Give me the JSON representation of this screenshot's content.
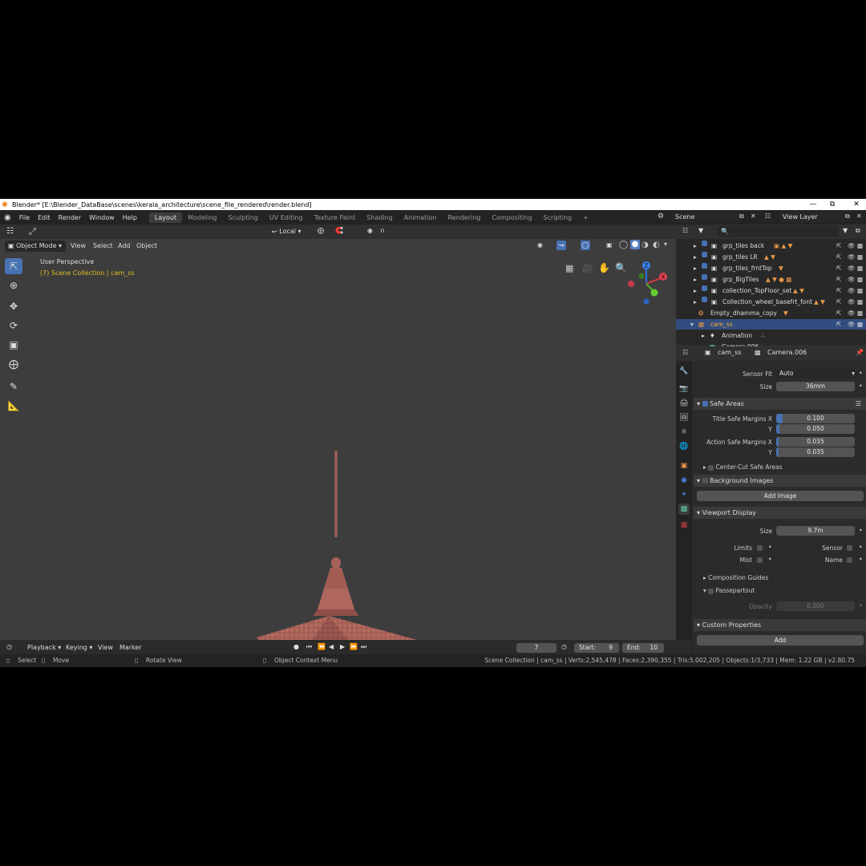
{
  "window": {
    "title": "Blender* [E:\\Blender_DataBase\\scenes\\kerala_architecture\\scene_file_rendered\\render.blend]"
  },
  "menu": {
    "file": "File",
    "edit": "Edit",
    "render": "Render",
    "window": "Window",
    "help": "Help"
  },
  "workspaces": [
    "Layout",
    "Modeling",
    "Sculpting",
    "UV Editing",
    "Texture Paint",
    "Shading",
    "Animation",
    "Rendering",
    "Compositing",
    "Scripting"
  ],
  "topright": {
    "scene": "Scene",
    "view_layer": "View Layer"
  },
  "viewport": {
    "mode": "Object Mode",
    "menus": {
      "view": "View",
      "select": "Select",
      "add": "Add",
      "object": "Object"
    },
    "orientation": "Local",
    "perspective": "User Perspective",
    "collection": "(7) Scene Collection | cam_ss",
    "gizmo": {
      "x": "X",
      "y": "Y",
      "z": "Z"
    }
  },
  "outliner": {
    "rows": [
      "grp_tiles back",
      "grp_tiles LR",
      "grp_tiles_frntTop",
      "grp_BigTiles",
      "collection_TopFloor_set",
      "Collection_wheel_basefrt_font",
      "Empty_dhamma_copy",
      "cam_ss",
      "Animation",
      "Camera.006"
    ]
  },
  "properties": {
    "breadcrumb_object": "cam_ss",
    "breadcrumb_data": "Camera.006",
    "sensor_fit_label": "Sensor Fit",
    "sensor_fit_value": "Auto",
    "size_label": "Size",
    "size_value": "36mm",
    "safe_areas": "Safe Areas",
    "title_safe_x_label": "Title Safe Margins X",
    "title_safe_x": "0.100",
    "y_label": "Y",
    "title_safe_y": "0.050",
    "action_safe_x_label": "Action Safe Margins X",
    "action_safe_x": "0.035",
    "action_safe_y": "0.035",
    "center_cut": "Center-Cut Safe Areas",
    "background_images": "Background Images",
    "add_image": "Add Image",
    "viewport_display": "Viewport Display",
    "vd_size_value": "9.7m",
    "limits": "Limits",
    "sensor": "Sensor",
    "mist": "Mist",
    "name": "Name",
    "composition_guides": "Composition Guides",
    "passepartout": "Passepartout",
    "opacity_label": "Opacity",
    "opacity_value": "0.000",
    "custom_properties": "Custom Properties",
    "add": "Add"
  },
  "timeline": {
    "playback": "Playback",
    "keying": "Keying",
    "view": "View",
    "marker": "Marker",
    "current_frame": "7",
    "start_label": "Start:",
    "start": "9",
    "end_label": "End:",
    "end": "10"
  },
  "status": {
    "select": "Select",
    "move": "Move",
    "rotate": "Rotate View",
    "context": "Object Context Menu",
    "stats": "Scene Collection | cam_ss | Verts:2,545,478 | Faces:2,390,355 | Tris:5,002,205 | Objects:1/3,733 | Mem: 1.22 GB | v2.80.75"
  }
}
